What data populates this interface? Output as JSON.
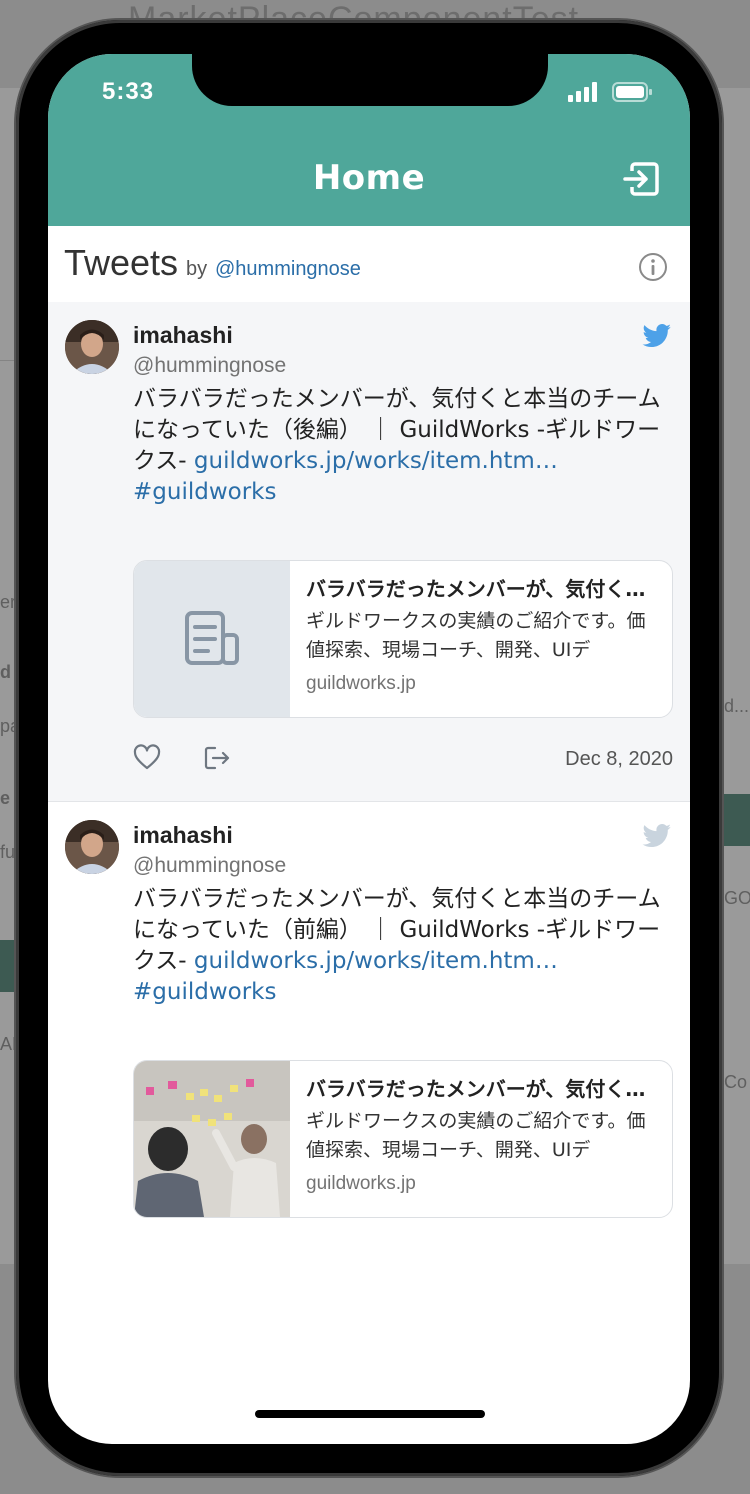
{
  "background_app": {
    "title": "MarketPlaceComponentTest...",
    "fragments": [
      "er",
      "d",
      "pa",
      "e",
      "fu",
      "AL",
      "d...",
      "GO",
      "Co"
    ]
  },
  "status_bar": {
    "time": "5:33"
  },
  "header": {
    "title": "Home",
    "logout_icon": "logout-icon",
    "color": "#4fa79a"
  },
  "tweets_section": {
    "title": "Tweets",
    "by": "by",
    "handle": "@hummingnose",
    "info_icon": "info-icon"
  },
  "tweets": [
    {
      "name": "imahashi",
      "handle": "@hummingnose",
      "text": "バラバラだったメンバーが、気付くと本当のチームになっていた（後編） ｜ GuildWorks -ギルドワークス- ",
      "link": "guildworks.jp/works/item.htm…",
      "hashtag": "#guildworks",
      "card": {
        "title": "バラバラだったメンバーが、気付く…",
        "description": "ギルドワークスの実績のご紹介です。価値探索、現場コーチ、開発、UIデ",
        "domain": "guildworks.jp",
        "thumbnail": "document-placeholder-icon"
      },
      "date": "Dec 8, 2020"
    },
    {
      "name": "imahashi",
      "handle": "@hummingnose",
      "text": "バラバラだったメンバーが、気付くと本当のチームになっていた（前編） ｜ GuildWorks -ギルドワークス- ",
      "link": "guildworks.jp/works/item.htm…",
      "hashtag": "#guildworks",
      "card": {
        "title": "バラバラだったメンバーが、気付く…",
        "description": "ギルドワークスの実績のご紹介です。価値探索、現場コーチ、開発、UIデ",
        "domain": "guildworks.jp",
        "thumbnail": "team-photo"
      }
    }
  ]
}
